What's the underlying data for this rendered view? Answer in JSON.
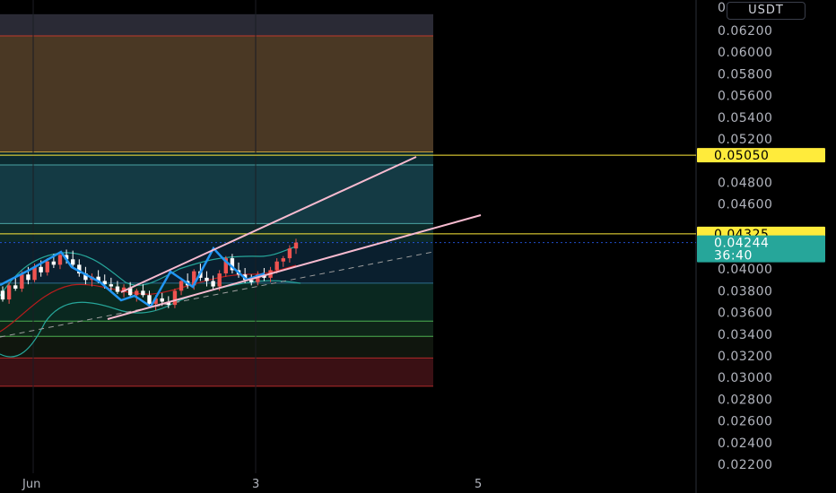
{
  "currency": "USDT",
  "colors": {
    "background": "#000000",
    "up": "#ef5350",
    "down": "#ffffff",
    "channel": "#f8bbd0",
    "zigzag": "#2196f3",
    "bands": "#26a69a",
    "level_yellow": "#ffeb3b",
    "last_price": "#26a69a"
  },
  "chart_data": {
    "type": "candlestick",
    "ylim": [
      0.021,
      0.0635
    ],
    "y_ticks": [
      "0.06200",
      "0.06000",
      "0.05800",
      "0.05600",
      "0.05400",
      "0.05200",
      "0.04800",
      "0.04600",
      "0.04000",
      "0.03800",
      "0.03600",
      "0.03400",
      "0.03200",
      "0.03000",
      "0.02800",
      "0.02600",
      "0.02400",
      "0.02200"
    ],
    "x_ticks": [
      "Jun",
      "3",
      "5"
    ],
    "price_labels": [
      {
        "label": "0.05050",
        "value": 0.0505,
        "kind": "level"
      },
      {
        "label": "0.04325",
        "value": 0.04325,
        "kind": "level"
      },
      {
        "label": "0.04244",
        "value": 0.04244,
        "kind": "last"
      }
    ],
    "countdown": "36:40",
    "zones": [
      {
        "from": 0.0635,
        "to": 0.0615,
        "color": "#2a2a35"
      },
      {
        "from": 0.0615,
        "to": 0.0508,
        "color": "#4a3824"
      },
      {
        "from": 0.0508,
        "to": 0.0496,
        "color": "#0b2a30"
      },
      {
        "from": 0.0496,
        "to": 0.0442,
        "color": "#143a44"
      },
      {
        "from": 0.0442,
        "to": 0.0425,
        "color": "#0d2a2a"
      },
      {
        "from": 0.0425,
        "to": 0.0387,
        "color": "#0a1f2e"
      },
      {
        "from": 0.0387,
        "to": 0.0352,
        "color": "#0a2820"
      },
      {
        "from": 0.0352,
        "to": 0.0338,
        "color": "#0e2418"
      },
      {
        "from": 0.0338,
        "to": 0.0318,
        "color": "#10160e"
      },
      {
        "from": 0.0318,
        "to": 0.0292,
        "color": "#3a1014"
      }
    ],
    "candles": [
      [
        0.038,
        0.0384,
        0.037,
        0.0372
      ],
      [
        0.0372,
        0.0388,
        0.0368,
        0.0385
      ],
      [
        0.0385,
        0.0392,
        0.038,
        0.0382
      ],
      [
        0.0382,
        0.0398,
        0.0379,
        0.0395
      ],
      [
        0.0395,
        0.0402,
        0.0386,
        0.039
      ],
      [
        0.039,
        0.0405,
        0.0388,
        0.0402
      ],
      [
        0.0402,
        0.0408,
        0.0393,
        0.0397
      ],
      [
        0.0397,
        0.041,
        0.0394,
        0.0407
      ],
      [
        0.0407,
        0.0414,
        0.0401,
        0.0404
      ],
      [
        0.0404,
        0.0416,
        0.04,
        0.0413
      ],
      [
        0.0413,
        0.0418,
        0.0405,
        0.0409
      ],
      [
        0.0409,
        0.0417,
        0.0402,
        0.0404
      ],
      [
        0.0404,
        0.0409,
        0.0393,
        0.0396
      ],
      [
        0.0396,
        0.0402,
        0.0386,
        0.039
      ],
      [
        0.039,
        0.0396,
        0.0384,
        0.0393
      ],
      [
        0.0393,
        0.0399,
        0.0387,
        0.0389
      ],
      [
        0.0389,
        0.0395,
        0.0382,
        0.0386
      ],
      [
        0.0386,
        0.0392,
        0.038,
        0.0384
      ],
      [
        0.0384,
        0.0389,
        0.0377,
        0.0379
      ],
      [
        0.0379,
        0.0386,
        0.0374,
        0.0383
      ],
      [
        0.0383,
        0.0388,
        0.0374,
        0.0376
      ],
      [
        0.0376,
        0.0382,
        0.037,
        0.038
      ],
      [
        0.038,
        0.0386,
        0.0374,
        0.0376
      ],
      [
        0.0376,
        0.038,
        0.0365,
        0.0368
      ],
      [
        0.0368,
        0.0376,
        0.0362,
        0.0373
      ],
      [
        0.0373,
        0.0378,
        0.0366,
        0.037
      ],
      [
        0.037,
        0.0375,
        0.0364,
        0.0367
      ],
      [
        0.0367,
        0.0382,
        0.0364,
        0.038
      ],
      [
        0.038,
        0.0392,
        0.0376,
        0.0389
      ],
      [
        0.0389,
        0.0396,
        0.0382,
        0.0385
      ],
      [
        0.0385,
        0.04,
        0.0381,
        0.0398
      ],
      [
        0.0398,
        0.0405,
        0.0389,
        0.0392
      ],
      [
        0.0392,
        0.0398,
        0.0384,
        0.0389
      ],
      [
        0.0389,
        0.0394,
        0.0381,
        0.0384
      ],
      [
        0.0384,
        0.0399,
        0.038,
        0.0396
      ],
      [
        0.0396,
        0.0412,
        0.0393,
        0.041
      ],
      [
        0.041,
        0.0414,
        0.0396,
        0.0399
      ],
      [
        0.0399,
        0.0406,
        0.0392,
        0.0395
      ],
      [
        0.0395,
        0.0401,
        0.0387,
        0.039
      ],
      [
        0.039,
        0.0395,
        0.0385,
        0.0388
      ],
      [
        0.0388,
        0.0398,
        0.0385,
        0.0395
      ],
      [
        0.0395,
        0.0401,
        0.0389,
        0.0392
      ],
      [
        0.0392,
        0.0402,
        0.0388,
        0.0399
      ],
      [
        0.0399,
        0.041,
        0.0396,
        0.0407
      ],
      [
        0.0407,
        0.0412,
        0.0402,
        0.041
      ],
      [
        0.041,
        0.0422,
        0.0406,
        0.0419
      ],
      [
        0.0419,
        0.0428,
        0.0414,
        0.04244
      ]
    ]
  }
}
